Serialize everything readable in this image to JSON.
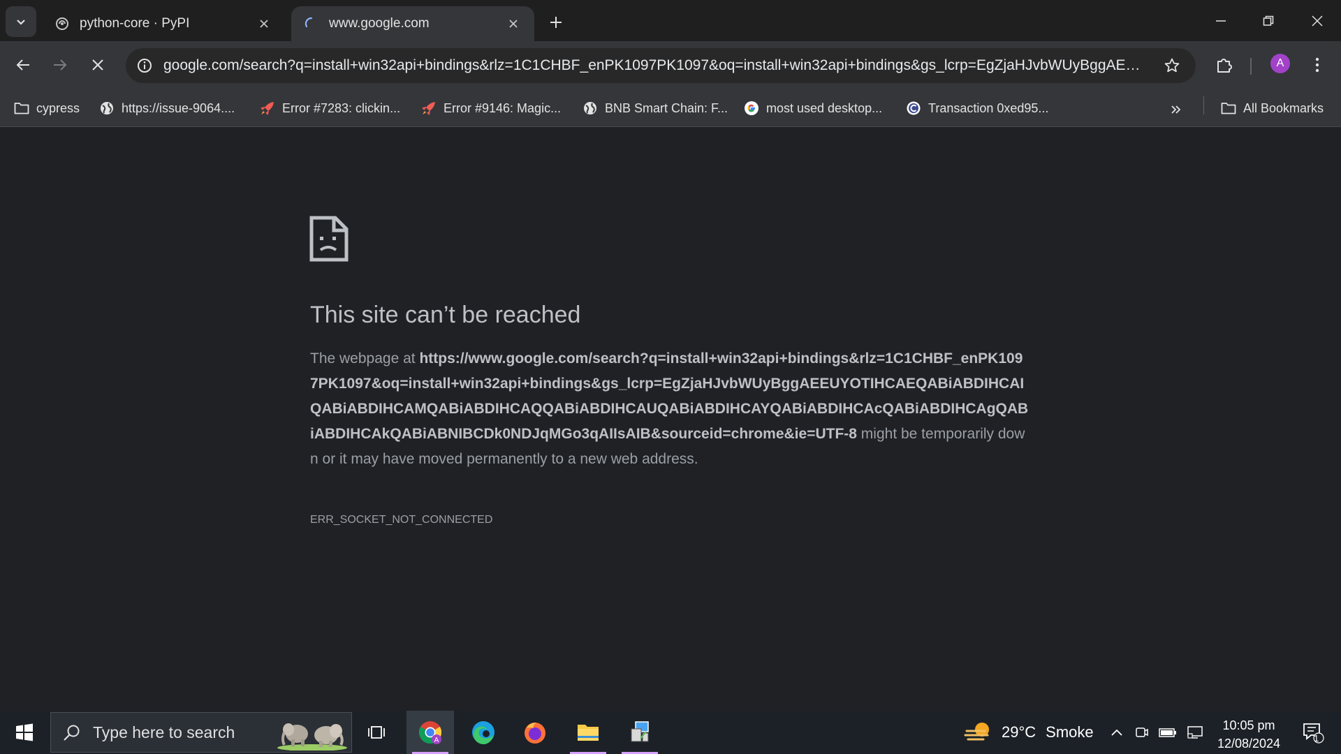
{
  "tabs": [
    {
      "title": "python-core · PyPI",
      "favicon": "pypi-icon"
    },
    {
      "title": "www.google.com",
      "favicon": "loading-spinner-icon"
    }
  ],
  "toolbar": {
    "url": "google.com/search?q=install+win32api+bindings&rlz=1C1CHBF_enPK1097PK1097&oq=install+win32api+bindings&gs_lcrp=EgZjaHJvbWUyBggAEEU...",
    "profile_initial": "A"
  },
  "bookmarks": {
    "items": [
      {
        "label": "cypress",
        "icon": "folder-icon"
      },
      {
        "label": "https://issue-9064....",
        "icon": "globe-icon"
      },
      {
        "label": "Error #7283: clickin...",
        "icon": "rocket-icon"
      },
      {
        "label": "Error #9146: Magic...",
        "icon": "rocket-icon"
      },
      {
        "label": "BNB Smart Chain: F...",
        "icon": "globe-icon"
      },
      {
        "label": "most used desktop...",
        "icon": "google-icon"
      },
      {
        "label": "Transaction 0xed95...",
        "icon": "etherscan-icon"
      }
    ],
    "all_bookmarks": "All Bookmarks"
  },
  "error": {
    "title": "This site can’t be reached",
    "prefix": "The webpage at ",
    "url": "https://www.google.com/search?q=install+win32api+bindings&rlz=1C1CHBF_enPK1097PK1097&oq=install+win32api+bindings&gs_lcrp=EgZjaHJvbWUyBggAEEUYOTIHCAEQABiABDIHCAIQABiABDIHCAMQABiABDIHCAQQABiABDIHCAUQABiABDIHCAYQABiABDIHCAcQABiABDIHCAgQABiABDIHCAkQABiABNIBCDk0NDJqMGo3qAIIsAIB&sourceid=chrome&ie=UTF-8",
    "suffix": " might be temporarily down or it may have moved permanently to a new web address.",
    "code": "ERR_SOCKET_NOT_CONNECTED"
  },
  "taskbar": {
    "search_placeholder": "Type here to search",
    "weather_temp": "29°C",
    "weather_text": "Smoke",
    "time": "10:05 pm",
    "date": "12/08/2024",
    "notification_count": "1"
  },
  "colors": {
    "accent_avatar": "#a142c9",
    "page_bg": "#202124",
    "toolbar_bg": "#35363a"
  }
}
